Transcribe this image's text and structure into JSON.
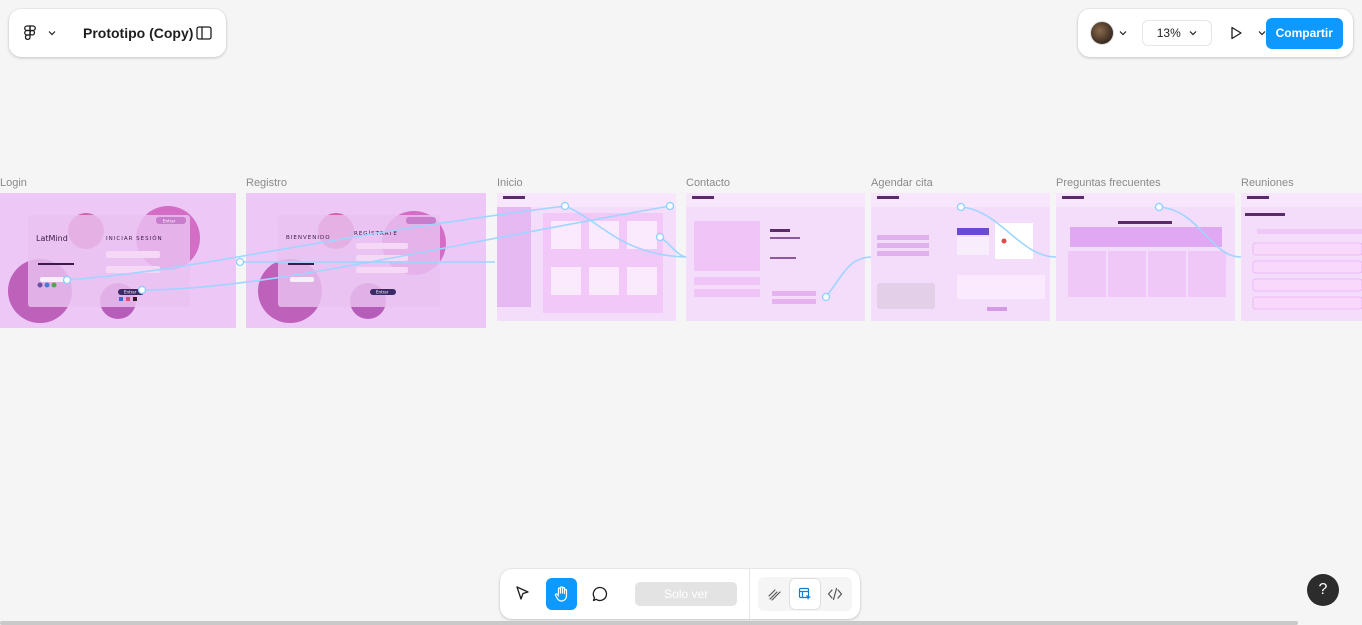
{
  "header": {
    "title": "Prototipo (Copy)",
    "zoom": "13%",
    "share_label": "Compartir"
  },
  "frames": [
    {
      "label": "Login",
      "logo": "LatMind",
      "heading": "INICIAR SESIÓN",
      "button": "Entrar"
    },
    {
      "label": "Registro",
      "heading": "BIENVENIDO",
      "heading2": "REGÍSTRATE",
      "button": "Entrar"
    },
    {
      "label": "Inicio"
    },
    {
      "label": "Contacto"
    },
    {
      "label": "Agendar cita"
    },
    {
      "label": "Preguntas frecuentes"
    },
    {
      "label": "Reuniones"
    }
  ],
  "toolbar": {
    "mode_label": "Solo ver"
  },
  "help": "?",
  "icons": {
    "figma": "figma-logo-icon",
    "sidebar": "sidebar-toggle-icon",
    "play": "play-icon",
    "move": "move-tool-icon",
    "hand": "hand-tool-icon",
    "comment": "comment-icon",
    "annotate": "annotate-icon",
    "inspect": "inspect-icon",
    "code": "code-icon"
  },
  "colors": {
    "accent": "#0d99ff",
    "canvas": "#f5f5f5",
    "frame_pink": "#edc8f7"
  }
}
